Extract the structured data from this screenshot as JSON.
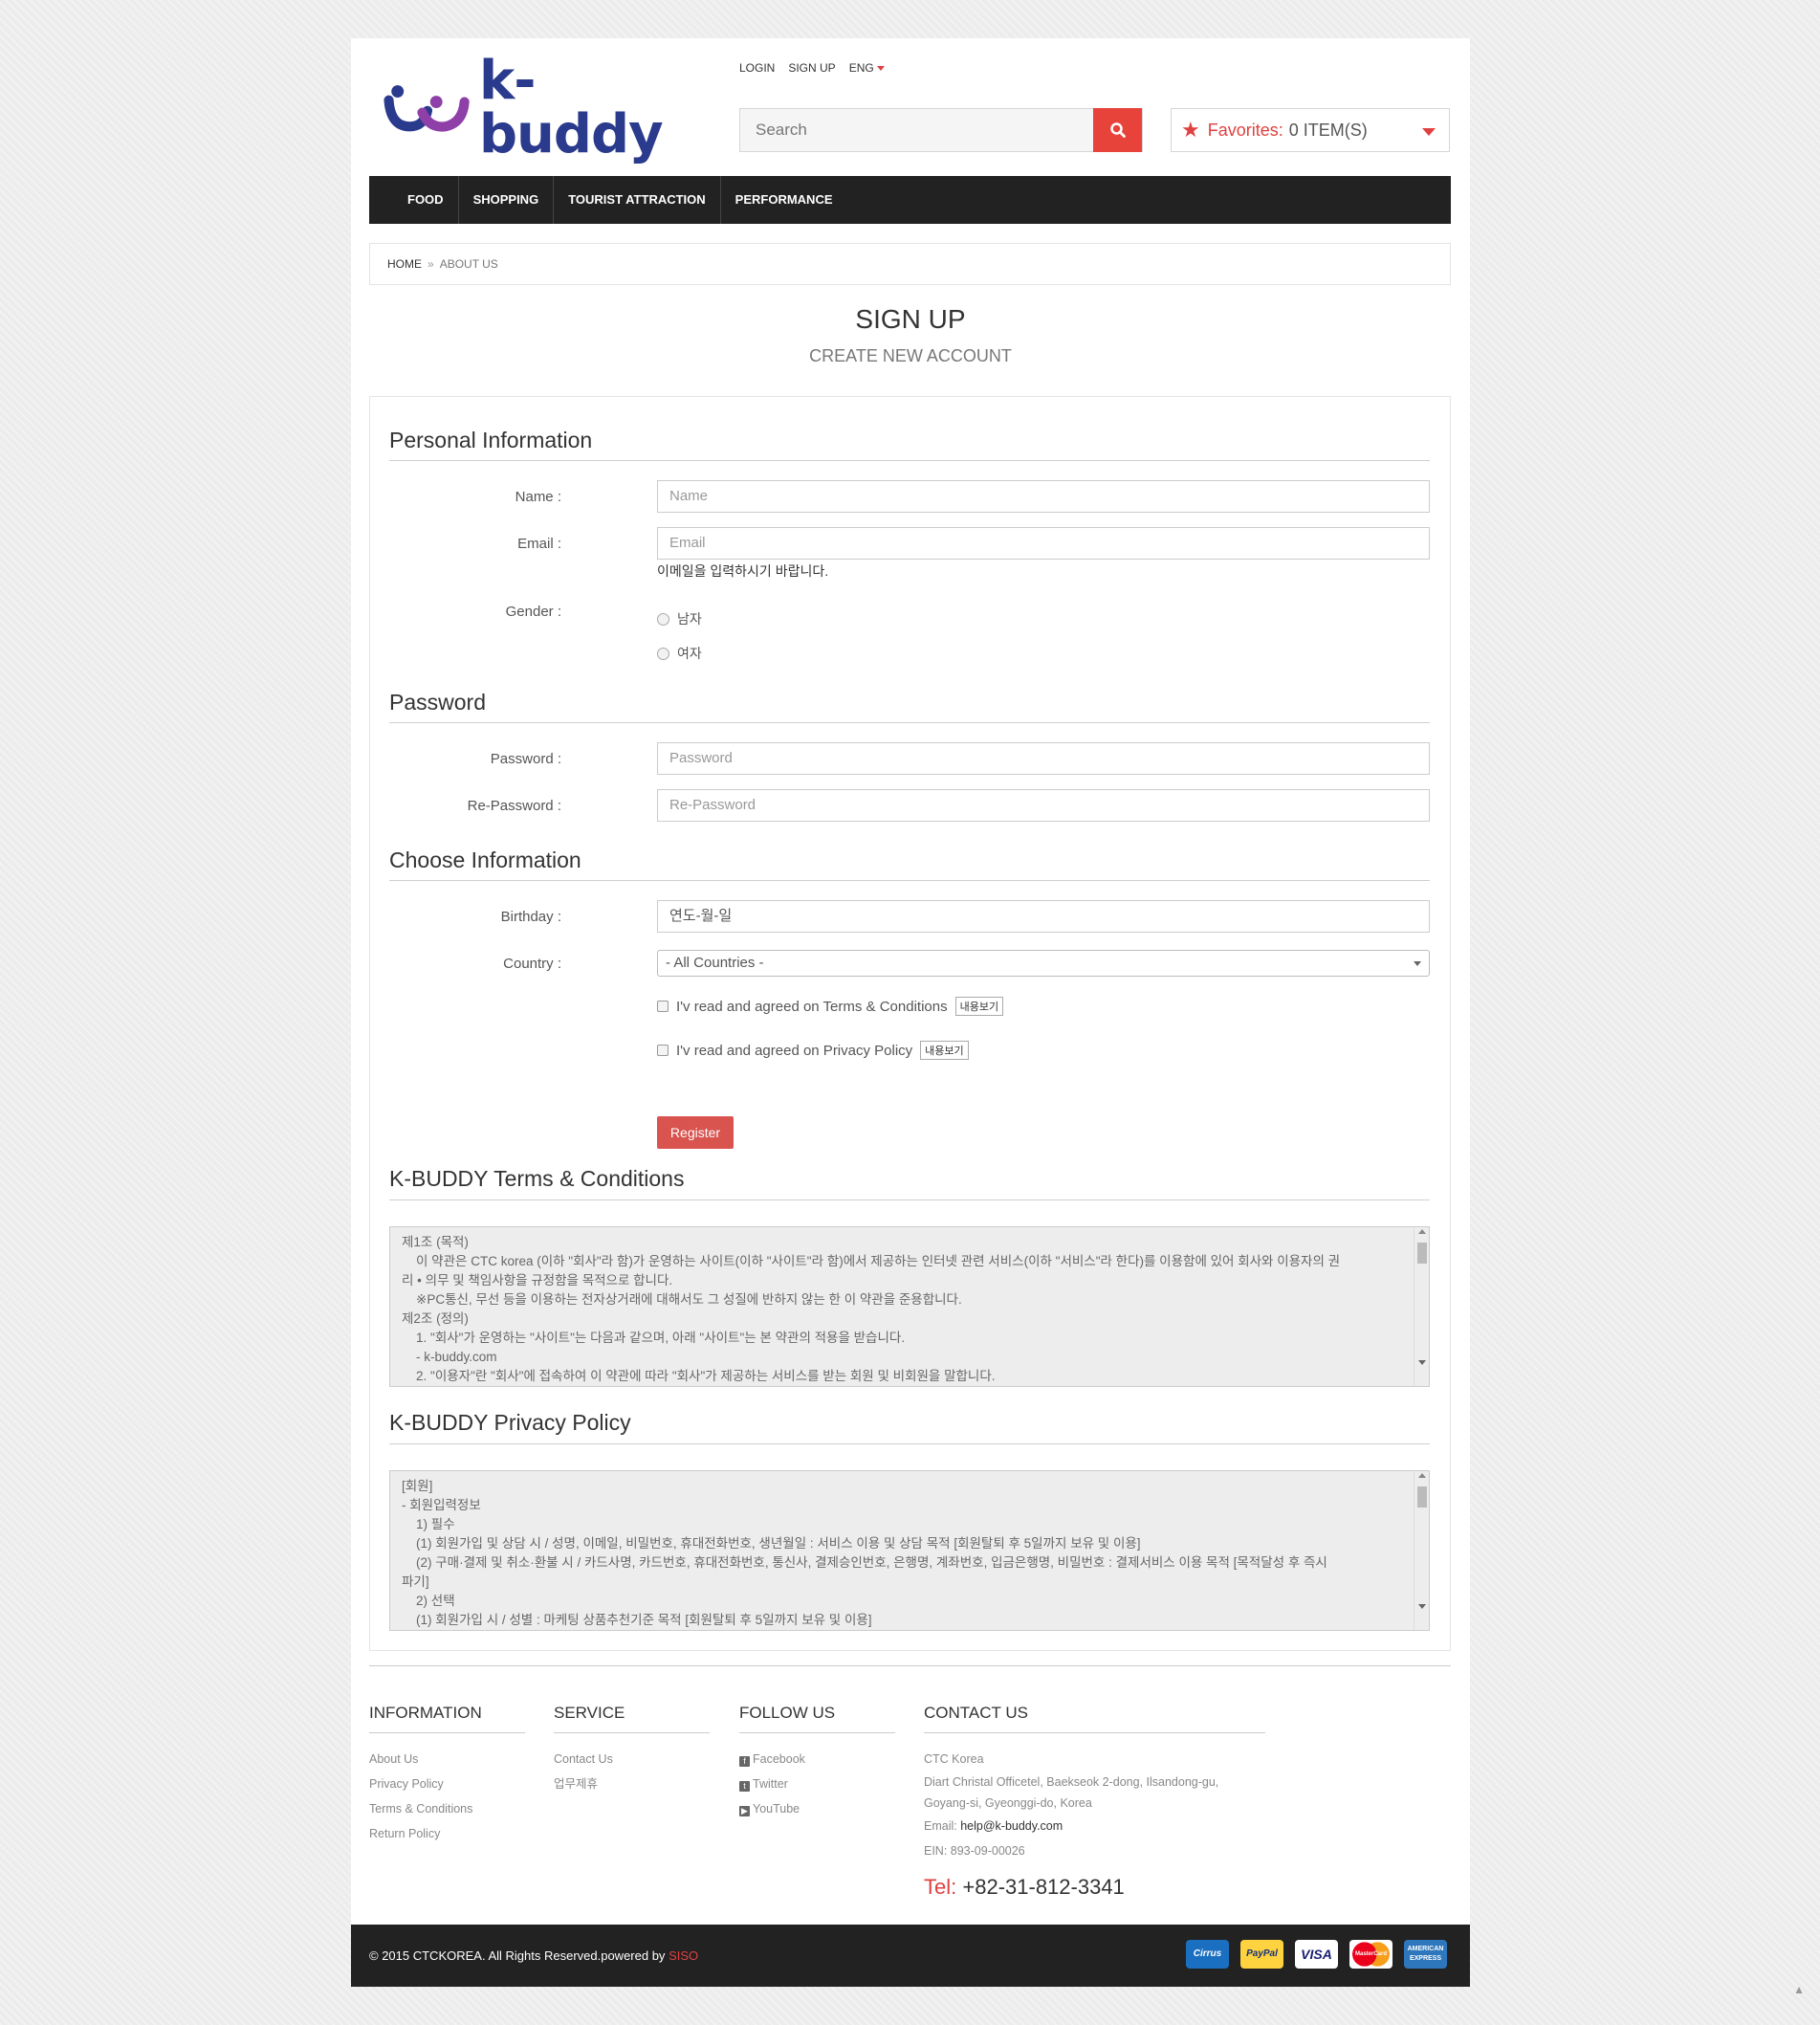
{
  "header": {
    "logo_text": "k-buddy",
    "toplinks": {
      "login": "LOGIN",
      "signup": "SIGN UP",
      "lang": "ENG"
    },
    "search_placeholder": "Search",
    "favorites": {
      "label": "Favorites:",
      "count": "0 ITEM(S)"
    }
  },
  "nav": [
    "FOOD",
    "SHOPPING",
    "TOURIST ATTRACTION",
    "PERFORMANCE"
  ],
  "breadcrumb": {
    "home": "HOME",
    "sep": "»",
    "current": "ABOUT US"
  },
  "page": {
    "title": "SIGN UP",
    "subtitle": "CREATE NEW ACCOUNT"
  },
  "personal": {
    "title": "Personal Information",
    "name_label": "Name :",
    "name_placeholder": "Name",
    "email_label": "Email :",
    "email_placeholder": "Email",
    "email_hint": "이메일을 입력하시기 바랍니다.",
    "gender_label": "Gender :",
    "gender_male": "남자",
    "gender_female": "여자"
  },
  "password": {
    "title": "Password",
    "password_label": "Password :",
    "password_placeholder": "Password",
    "repassword_label": "Re-Password :",
    "repassword_placeholder": "Re-Password"
  },
  "choose": {
    "title": "Choose Information",
    "birthday_label": "Birthday :",
    "birthday_value": "연도-월-일",
    "country_label": "Country :",
    "country_value": "- All Countries -",
    "terms_check": "I'v read and agreed on Terms & Conditions",
    "privacy_check": "I'v read and agreed on Privacy Policy",
    "view_button": "내용보기",
    "register": "Register"
  },
  "terms": {
    "title": "K-BUDDY Terms & Conditions",
    "lines": [
      "제1조 (목적)",
      "    이 약관은 CTC korea (이하 \"회사\"라 함)가 운영하는 사이트(이하 \"사이트\"라 함)에서 제공하는 인터넷 관련 서비스(이하 \"서비스\"라 한다)를 이용함에 있어 회사와 이용자의 권",
      "리 • 의무 및 책임사항을 규정함을 목적으로 합니다.",
      "    ※PC통신, 무선 등을 이용하는 전자상거래에 대해서도 그 성질에 반하지 않는 한 이 약관을 준용합니다.",
      "제2조 (정의)",
      "    1. \"회사\"가 운영하는 \"사이트\"는 다음과 같으며, 아래 \"사이트\"는 본 약관의 적용을 받습니다.",
      "    - k-buddy.com",
      "    2. \"이용자\"란 \"회사\"에 접속하여 이 약관에 따라 \"회사\"가 제공하는 서비스를 받는 회원 및 비회원을 말합니다."
    ]
  },
  "privacy": {
    "title": "K-BUDDY Privacy Policy",
    "lines": [
      "[회원]",
      "- 회원입력정보",
      "    1) 필수",
      "    (1) 회원가입 및 상담 시 / 성명, 이메일, 비밀번호, 휴대전화번호, 생년월일 : 서비스 이용 및 상담 목적 [회원탈퇴 후 5일까지 보유 및 이용]",
      "    (2) 구매·결제 및 취소·환불 시 / 카드사명, 카드번호, 휴대전화번호, 통신사, 결제승인번호, 은행명, 계좌번호, 입금은행명, 비밀번호 : 결제서비스 이용 목적 [목적달성 후 즉시",
      "파기]",
      "    2) 선택",
      "    (1) 회원가입 시 / 성별 : 마케팅 상품추천기준 목적 [회원탈퇴 후 5일까지 보유 및 이용]"
    ]
  },
  "footer": {
    "information": {
      "title": "INFORMATION",
      "items": [
        "About Us",
        "Privacy Policy",
        "Terms & Conditions",
        "Return Policy"
      ]
    },
    "service": {
      "title": "SERVICE",
      "items": [
        "Contact Us",
        "업무제휴"
      ]
    },
    "follow": {
      "title": "FOLLOW US",
      "items": [
        "Facebook",
        "Twitter",
        "YouTube"
      ]
    },
    "contact": {
      "title": "CONTACT US",
      "company": "CTC Korea",
      "address1": "Diart Christal Officetel, Baekseok 2-dong, Ilsandong-gu,",
      "address2": "Goyang-si, Gyeonggi-do, Korea",
      "email_label": "Email:",
      "email": "help@k-buddy.com",
      "ein": "EIN: 893-09-00026",
      "tel_label": "Tel:",
      "tel": "+82-31-812-3341"
    },
    "copyright": "© 2015 CTCKOREA. All Rights Reserved.powered by",
    "powered": "SISO",
    "cards": [
      "Cirrus",
      "PayPal",
      "VISA",
      "MasterCard",
      "AMERICAN EXPRESS"
    ]
  },
  "colors": {
    "accent": "#e8433b",
    "nav": "#222222",
    "brand": "#2a3a8c",
    "brand_purple": "#8e3fa8"
  }
}
